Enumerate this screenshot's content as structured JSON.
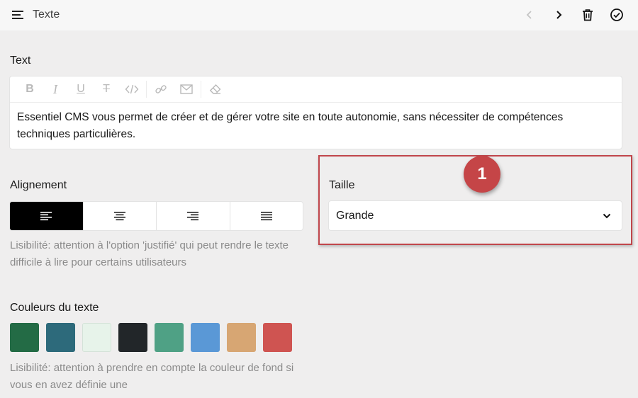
{
  "topbar": {
    "title": "Texte",
    "icons": [
      "menu-icon",
      "chevron-left-icon",
      "chevron-right-icon",
      "trash-icon",
      "check-circle-icon"
    ]
  },
  "text_section": {
    "label": "Text",
    "toolbar": [
      "bold-icon",
      "italic-icon",
      "underline-icon",
      "strikethrough-icon",
      "code-icon",
      "link-icon",
      "mail-icon",
      "eraser-icon"
    ],
    "content": "Essentiel CMS vous permet de créer et de gérer votre site en toute autonomie, sans nécessiter de compétences techniques particulières."
  },
  "alignment": {
    "label": "Alignement",
    "options": [
      "align-left-icon",
      "align-center-icon",
      "align-right-icon",
      "align-justify-icon"
    ],
    "selected": "align-left-icon",
    "help": "Lisibilité: attention à l'option 'justifié' qui peut rendre le texte difficile à lire pour certains utilisateurs"
  },
  "size": {
    "label": "Taille",
    "value": "Grande",
    "callout_number": "1"
  },
  "colors": {
    "label": "Couleurs du texte",
    "swatches": [
      "#236b45",
      "#2d6a7b",
      "#e7f3ea",
      "#222629",
      "#4fa185",
      "#5a98d6",
      "#d7a673",
      "#cf5451"
    ],
    "help": "Lisibilité: attention à prendre en compte la couleur de fond si vous en avez définie une"
  },
  "theme": {
    "accent_callout": "#c0464b",
    "active_align": "#000000"
  }
}
